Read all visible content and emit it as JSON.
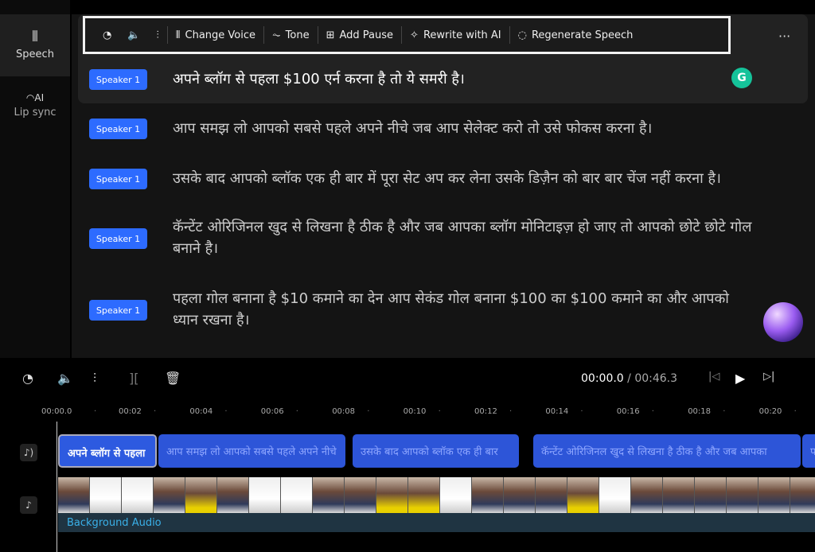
{
  "sidebar": {
    "items": [
      {
        "label": "Speech",
        "icon": "speech-wand-icon",
        "active": true
      },
      {
        "label": "Lip sync",
        "icon": "ai-lip-icon",
        "active": false
      }
    ]
  },
  "toolbar": {
    "items": [
      {
        "icon": "speed-icon"
      },
      {
        "icon": "volume-icon"
      },
      {
        "icon": "equalizer-icon"
      },
      {
        "icon": "waveform-icon",
        "label": "Change Voice"
      },
      {
        "icon": "tone-icon",
        "label": "Tone"
      },
      {
        "icon": "add-pause-icon",
        "label": "Add Pause"
      },
      {
        "icon": "magic-wand-icon",
        "label": "Rewrite with AI"
      },
      {
        "icon": "regenerate-icon",
        "label": "Regenerate Speech"
      }
    ],
    "more": "···"
  },
  "script": {
    "rows": [
      {
        "speaker": "Speaker 1",
        "text": "अपने ब्लॉग से पहला $100 एर्न करना है तो ये समरी है।"
      },
      {
        "speaker": "Speaker 1",
        "text": "आप समझ लो आपको सबसे पहले अपने नीचे जब आप सेलेक्ट करो तो उसे फोकस करना है।"
      },
      {
        "speaker": "Speaker 1",
        "text": "उसके बाद आपको ब्लॉक एक ही बार में पूरा सेट अप कर लेना उसके डिज़ैन को बार बार चेंज नहीं करना है।"
      },
      {
        "speaker": "Speaker 1",
        "text": "कॅन्टेंट ओरिजिनल खुद से लिखना है ठीक है और जब आपका ब्लॉग मोनिटाइज़ हो जाए तो आपको छोटे छोटे गोल बनाने है।"
      },
      {
        "speaker": "Speaker 1",
        "text": "पहला गोल बनाना है $10 कमाने का देन आप सेकंड गोल बनाना $100 का $100 कमाने का और आपको ध्यान रखना है।"
      }
    ]
  },
  "player": {
    "current": "00:00.0",
    "separator": " / ",
    "total": "00:46.3"
  },
  "ruler": [
    "00:00.0",
    "00:02",
    "00:04",
    "00:06",
    "00:08",
    "00:10",
    "00:12",
    "00:14",
    "00:16",
    "00:18",
    "00:20"
  ],
  "clips": [
    "अपने ब्लॉग से पहला",
    "आप समझ लो आपको सबसे पहले अपने नीचे",
    "उसके बाद आपको ब्लॉक एक ही बार",
    "कॅन्टेंट ओरिजिनल खुद से लिखना है ठीक है और जब आपका",
    "पहला"
  ],
  "audio_label": "Background Audio",
  "colors": {
    "accent": "#2d6bff",
    "clip": "#2d55d8",
    "audio": "#3ab0e8"
  }
}
